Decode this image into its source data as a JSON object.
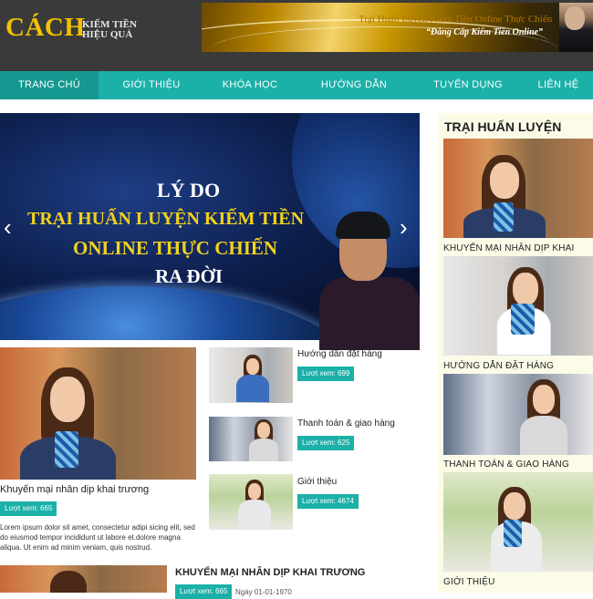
{
  "header": {
    "logo_main": "CÁCH",
    "logo_line1": "KIẾM TIỀN",
    "logo_line2": "HIỆU QUẢ",
    "banner_line1": "Trại Huấn Luyện Kiếm Tiền Online Thực Chiến",
    "banner_line2": "“Đẳng Cấp Kiếm Tiền Online”"
  },
  "nav": {
    "items": [
      {
        "label": "Trang chủ",
        "active": true
      },
      {
        "label": "Giới thiệu"
      },
      {
        "label": "Khóa học"
      },
      {
        "label": "Hướng dẫn"
      },
      {
        "label": "Tuyển dụng"
      },
      {
        "label": "Liên hệ"
      }
    ]
  },
  "slider": {
    "line1": "LÝ DO",
    "line2": "TRẠI HUẤN LUYỆN KIẾM TIỀN",
    "line3": "ONLINE THỰC CHIẾN",
    "line4": "RA ĐỜI",
    "prev_icon": "‹",
    "next_icon": "›"
  },
  "featured": {
    "title": "Khuyến mại nhân dịp khai trương",
    "views": "Lượt xem: 665",
    "excerpt": "Lorem ipsum dolor sit amet, consectetur adipi sicing elit, sed do eiusmod tempor incididunt ut labore et.dolore magna aliqua. Ut enim ad minim veniam, quis nostrud."
  },
  "posts": [
    {
      "title": "Hướng dẫn đặt hàng",
      "views": "Lượt xem: 699"
    },
    {
      "title": "Thanh toán & giao hàng",
      "views": "Lượt xem: 625"
    },
    {
      "title": "Giới thiệu",
      "views": "Lượt xem: 4674"
    }
  ],
  "bottom_post": {
    "title": "KHUYẾN MẠI NHÂN DỊP KHAI TRƯƠNG",
    "views": "Lượt xem: 665",
    "date": "Ngày 01-01-1970"
  },
  "sidebar": {
    "title": "TRẠI HUẤN LUYỆN",
    "items": [
      {
        "label": "KHUYẾN MẠI NHÂN DỊP KHAI"
      },
      {
        "label": "HƯỚNG DẪN ĐẶT HÀNG"
      },
      {
        "label": "THANH TOÁN & GIAO HÀNG"
      },
      {
        "label": "GIỚI THIỆU"
      }
    ]
  },
  "colors": {
    "nav": "#1bb0a8",
    "header": "#3a3a3a",
    "logo": "#f2c200",
    "sidebar_bg": "#fbfbe8"
  }
}
